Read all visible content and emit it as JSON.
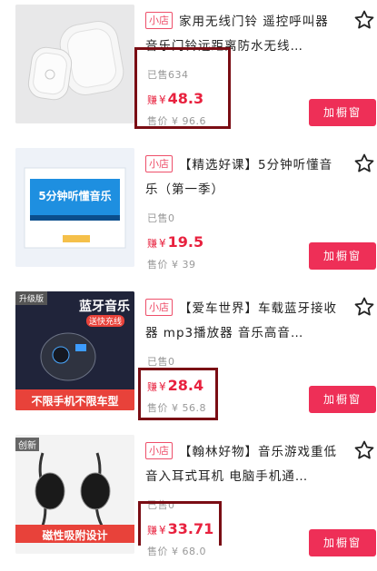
{
  "products": [
    {
      "shop_tag": "小店",
      "title": "家用无线门铃 遥控呼叫器 音乐门铃远距离防水无线…",
      "sold": "已售634",
      "earn_label": "赚",
      "currency": "¥",
      "earn_value": "48.3",
      "price_label": "售价",
      "price_value": "¥ 96.6",
      "button": "加橱窗"
    },
    {
      "shop_tag": "小店",
      "title": "【精选好课】5分钟听懂音乐（第一季）",
      "sold": "已售0",
      "earn_label": "赚",
      "currency": "¥",
      "earn_value": "19.5",
      "price_label": "售价",
      "price_value": "¥ 39",
      "button": "加橱窗",
      "thumb_text": "5分钟听懂音乐"
    },
    {
      "shop_tag": "小店",
      "title": "【爱车世界】车载蓝牙接收器 mp3播放器 音乐高音…",
      "sold": "已售0",
      "earn_label": "赚",
      "currency": "¥",
      "earn_value": "28.4",
      "price_label": "售价",
      "price_value": "¥ 56.8",
      "button": "加橱窗",
      "thumb_badge": "升级版",
      "thumb_title": "蓝牙音乐",
      "thumb_sub": "送快充线",
      "thumb_bottom": "不限手机不限车型"
    },
    {
      "shop_tag": "小店",
      "title": "【翰林好物】音乐游戏重低音入耳式耳机 电脑手机通…",
      "sold": "已售0",
      "earn_label": "赚",
      "currency": "¥",
      "earn_value": "33.71",
      "price_label": "售价",
      "price_value": "¥ 68.0",
      "button": "加橱窗",
      "thumb_badge": "创新",
      "thumb_bottom": "磁性吸附设计"
    }
  ],
  "colors": {
    "accent": "#ee2f57",
    "price": "#e8213e",
    "highlight": "#7a0d14"
  }
}
